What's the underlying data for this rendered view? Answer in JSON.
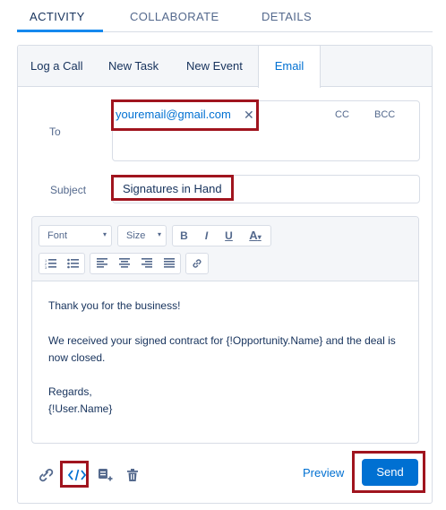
{
  "top_tabs": [
    {
      "label": "ACTIVITY",
      "active": true
    },
    {
      "label": "COLLABORATE",
      "active": false
    },
    {
      "label": "DETAILS",
      "active": false
    }
  ],
  "sub_tabs": [
    {
      "label": "Log a Call",
      "active": false
    },
    {
      "label": "New Task",
      "active": false
    },
    {
      "label": "New Event",
      "active": false
    },
    {
      "label": "Email",
      "active": true
    }
  ],
  "form": {
    "to_label": "To",
    "to_recipient": "youremail@gmail.com",
    "remove_icon": "close-icon",
    "cc_label": "CC",
    "bcc_label": "BCC",
    "subject_label": "Subject",
    "subject_value": "Signatures in Hand"
  },
  "toolbar": {
    "font_select": "Font",
    "size_select": "Size",
    "bold": "B",
    "italic": "I",
    "underline": "U",
    "font_color": "A",
    "icons": [
      "numbered-list-icon",
      "bulleted-list-icon",
      "align-left-icon",
      "align-center-icon",
      "align-right-icon",
      "justify-icon",
      "link-icon"
    ]
  },
  "body": {
    "line1": "Thank you for the business!",
    "line2": "We received your signed contract for {!Opportunity.Name} and the deal is now closed.",
    "line3": "Regards,",
    "line4": "{!User.Name}"
  },
  "footer": {
    "icons": [
      "attach-icon",
      "insert-merge-field-icon",
      "template-icon",
      "delete-icon"
    ],
    "preview_label": "Preview",
    "send_label": "Send"
  },
  "colors": {
    "accent": "#0070d2",
    "highlight": "#a0141e",
    "text": "#16325c",
    "muted": "#54698d",
    "border": "#d8dde6"
  }
}
